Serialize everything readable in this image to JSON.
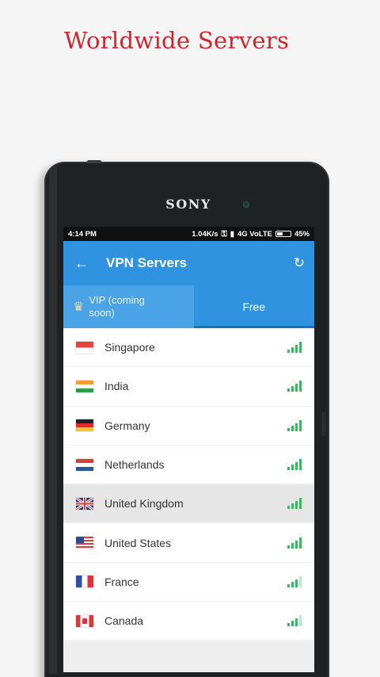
{
  "promo": {
    "headline": "Worldwide Servers"
  },
  "device": {
    "brand": "SONY"
  },
  "status_bar": {
    "time": "4:14 PM",
    "speed": "1.04K/s",
    "network": "4G VoLTE",
    "battery": "45%"
  },
  "app_bar": {
    "title": "VPN Servers"
  },
  "tabs": [
    {
      "label": "VIP (coming soon)",
      "icon": "crown-icon",
      "selected": false
    },
    {
      "label": "Free",
      "selected": true
    }
  ],
  "servers": [
    {
      "country": "Singapore",
      "signal": 4,
      "selected": false
    },
    {
      "country": "India",
      "signal": 4,
      "selected": false
    },
    {
      "country": "Germany",
      "signal": 4,
      "selected": false
    },
    {
      "country": "Netherlands",
      "signal": 4,
      "selected": false
    },
    {
      "country": "United Kingdom",
      "signal": 4,
      "selected": true
    },
    {
      "country": "United States",
      "signal": 4,
      "selected": false
    },
    {
      "country": "France",
      "signal": 3,
      "selected": false
    },
    {
      "country": "Canada",
      "signal": 3,
      "selected": false
    }
  ],
  "colors": {
    "accent": "#2f93e0",
    "headline": "#d3242c",
    "signal": "#2fbf5a"
  }
}
